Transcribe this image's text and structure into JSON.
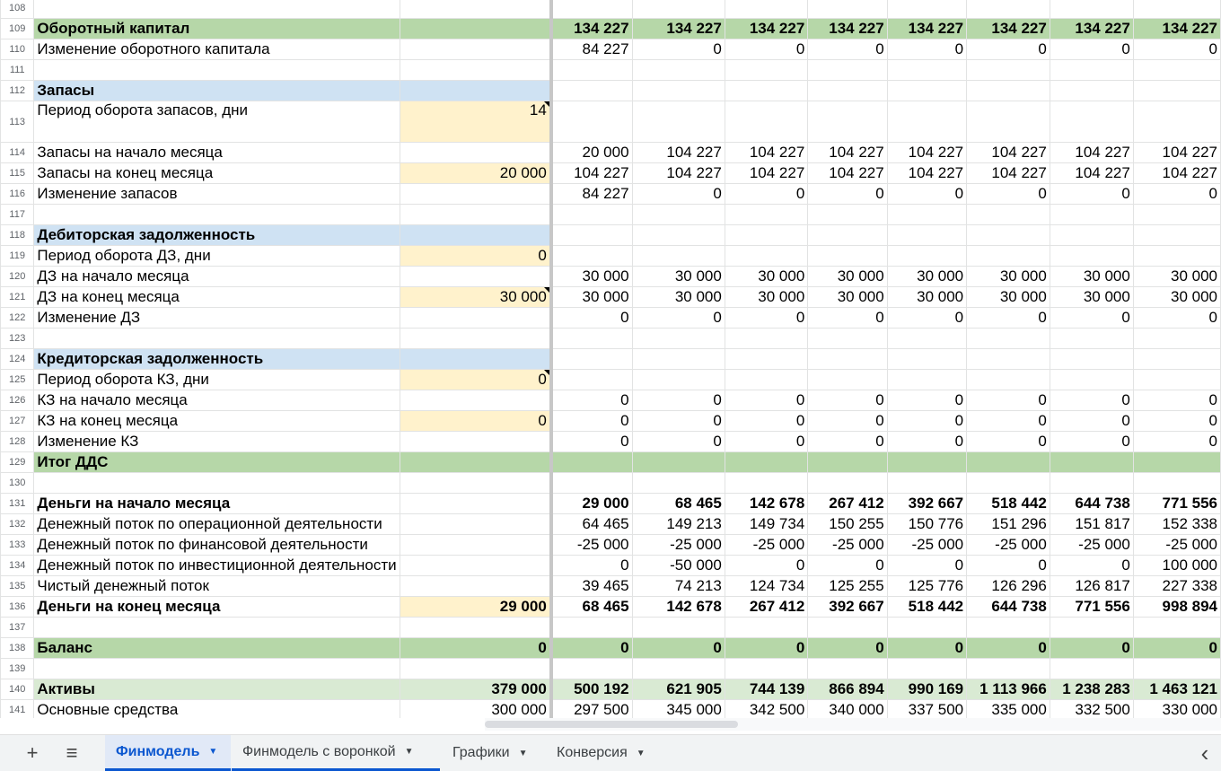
{
  "rows": [
    {
      "n": "108",
      "label": "",
      "input": "",
      "vals": [
        "",
        "",
        "",
        "",
        "",
        "",
        "",
        ""
      ],
      "style": ""
    },
    {
      "n": "109",
      "label": "Оборотный капитал",
      "input": "",
      "vals": [
        "134 227",
        "134 227",
        "134 227",
        "134 227",
        "134 227",
        "134 227",
        "134 227",
        "134 227"
      ],
      "style": "green"
    },
    {
      "n": "110",
      "label": "Изменение оборотного капитала",
      "input": "",
      "vals": [
        "84 227",
        "0",
        "0",
        "0",
        "0",
        "0",
        "0",
        "0"
      ],
      "style": ""
    },
    {
      "n": "111",
      "label": "",
      "input": "",
      "vals": [
        "",
        "",
        "",
        "",
        "",
        "",
        "",
        ""
      ],
      "style": ""
    },
    {
      "n": "112",
      "label": "Запасы",
      "input": "",
      "vals": [
        "",
        "",
        "",
        "",
        "",
        "",
        "",
        ""
      ],
      "style": "blue"
    },
    {
      "n": "113",
      "label": "Период оборота запасов, дни",
      "input": "14",
      "vals": [
        "",
        "",
        "",
        "",
        "",
        "",
        "",
        ""
      ],
      "style": "tall",
      "inputCell": true,
      "note": true
    },
    {
      "n": "114",
      "label": "Запасы на начало месяца",
      "input": "",
      "vals": [
        "20 000",
        "104 227",
        "104 227",
        "104 227",
        "104 227",
        "104 227",
        "104 227",
        "104 227"
      ],
      "style": ""
    },
    {
      "n": "115",
      "label": "Запасы на конец месяца",
      "input": "20 000",
      "vals": [
        "104 227",
        "104 227",
        "104 227",
        "104 227",
        "104 227",
        "104 227",
        "104 227",
        "104 227"
      ],
      "style": "",
      "inputCell": true
    },
    {
      "n": "116",
      "label": "Изменение запасов",
      "input": "",
      "vals": [
        "84 227",
        "0",
        "0",
        "0",
        "0",
        "0",
        "0",
        "0"
      ],
      "style": ""
    },
    {
      "n": "117",
      "label": "",
      "input": "",
      "vals": [
        "",
        "",
        "",
        "",
        "",
        "",
        "",
        ""
      ],
      "style": ""
    },
    {
      "n": "118",
      "label": "Дебиторская задолженность",
      "input": "",
      "vals": [
        "",
        "",
        "",
        "",
        "",
        "",
        "",
        ""
      ],
      "style": "blue"
    },
    {
      "n": "119",
      "label": "Период оборота ДЗ, дни",
      "input": "0",
      "vals": [
        "",
        "",
        "",
        "",
        "",
        "",
        "",
        ""
      ],
      "style": "",
      "inputCell": true
    },
    {
      "n": "120",
      "label": "ДЗ на начало месяца",
      "input": "",
      "vals": [
        "30 000",
        "30 000",
        "30 000",
        "30 000",
        "30 000",
        "30 000",
        "30 000",
        "30 000"
      ],
      "style": ""
    },
    {
      "n": "121",
      "label": "ДЗ на конец месяца",
      "input": "30 000",
      "vals": [
        "30 000",
        "30 000",
        "30 000",
        "30 000",
        "30 000",
        "30 000",
        "30 000",
        "30 000"
      ],
      "style": "",
      "inputCell": true,
      "note": true
    },
    {
      "n": "122",
      "label": "Изменение ДЗ",
      "input": "",
      "vals": [
        "0",
        "0",
        "0",
        "0",
        "0",
        "0",
        "0",
        "0"
      ],
      "style": ""
    },
    {
      "n": "123",
      "label": "",
      "input": "",
      "vals": [
        "",
        "",
        "",
        "",
        "",
        "",
        "",
        ""
      ],
      "style": ""
    },
    {
      "n": "124",
      "label": "Кредиторская задолженность",
      "input": "",
      "vals": [
        "",
        "",
        "",
        "",
        "",
        "",
        "",
        ""
      ],
      "style": "blue"
    },
    {
      "n": "125",
      "label": "Период оборота КЗ, дни",
      "input": "0",
      "vals": [
        "",
        "",
        "",
        "",
        "",
        "",
        "",
        ""
      ],
      "style": "",
      "inputCell": true,
      "note": true
    },
    {
      "n": "126",
      "label": "КЗ на начало месяца",
      "input": "",
      "vals": [
        "0",
        "0",
        "0",
        "0",
        "0",
        "0",
        "0",
        "0"
      ],
      "style": ""
    },
    {
      "n": "127",
      "label": "КЗ на конец месяца",
      "input": "0",
      "vals": [
        "0",
        "0",
        "0",
        "0",
        "0",
        "0",
        "0",
        "0"
      ],
      "style": "",
      "inputCell": true
    },
    {
      "n": "128",
      "label": "Изменение КЗ",
      "input": "",
      "vals": [
        "0",
        "0",
        "0",
        "0",
        "0",
        "0",
        "0",
        "0"
      ],
      "style": ""
    },
    {
      "n": "129",
      "label": "Итог ДДС",
      "input": "",
      "vals": [
        "",
        "",
        "",
        "",
        "",
        "",
        "",
        ""
      ],
      "style": "green"
    },
    {
      "n": "130",
      "label": "",
      "input": "",
      "vals": [
        "",
        "",
        "",
        "",
        "",
        "",
        "",
        ""
      ],
      "style": ""
    },
    {
      "n": "131",
      "label": "Деньги на начало месяца",
      "input": "",
      "vals": [
        "29 000",
        "68 465",
        "142 678",
        "267 412",
        "392 667",
        "518 442",
        "644 738",
        "771 556"
      ],
      "style": "bold"
    },
    {
      "n": "132",
      "label": "Денежный поток по операционной деятельности",
      "input": "",
      "vals": [
        "64 465",
        "149 213",
        "149 734",
        "150 255",
        "150 776",
        "151 296",
        "151 817",
        "152 338"
      ],
      "style": ""
    },
    {
      "n": "133",
      "label": "Денежный поток по финансовой деятельности",
      "input": "",
      "vals": [
        "-25 000",
        "-25 000",
        "-25 000",
        "-25 000",
        "-25 000",
        "-25 000",
        "-25 000",
        "-25 000"
      ],
      "style": ""
    },
    {
      "n": "134",
      "label": "Денежный поток по инвестиционной деятельности",
      "input": "",
      "vals": [
        "0",
        "-50 000",
        "0",
        "0",
        "0",
        "0",
        "0",
        "100 000"
      ],
      "style": ""
    },
    {
      "n": "135",
      "label": "Чистый денежный поток",
      "input": "",
      "vals": [
        "39 465",
        "74 213",
        "124 734",
        "125 255",
        "125 776",
        "126 296",
        "126 817",
        "227 338"
      ],
      "style": ""
    },
    {
      "n": "136",
      "label": "Деньги на конец месяца",
      "input": "29 000",
      "vals": [
        "68 465",
        "142 678",
        "267 412",
        "392 667",
        "518 442",
        "644 738",
        "771 556",
        "998 894"
      ],
      "style": "bold",
      "inputCell": true
    },
    {
      "n": "137",
      "label": "",
      "input": "",
      "vals": [
        "",
        "",
        "",
        "",
        "",
        "",
        "",
        ""
      ],
      "style": ""
    },
    {
      "n": "138",
      "label": "Баланс",
      "input": "0",
      "vals": [
        "0",
        "0",
        "0",
        "0",
        "0",
        "0",
        "0",
        "0"
      ],
      "style": "green bold"
    },
    {
      "n": "139",
      "label": "",
      "input": "",
      "vals": [
        "",
        "",
        "",
        "",
        "",
        "",
        "",
        ""
      ],
      "style": ""
    },
    {
      "n": "140",
      "label": "Активы",
      "input": "379 000",
      "vals": [
        "500 192",
        "621 905",
        "744 139",
        "866 894",
        "990 169",
        "1 113 966",
        "1 238 283",
        "1 463 121"
      ],
      "style": "lgreen bold"
    },
    {
      "n": "141",
      "label": "Основные средства",
      "input": "300 000",
      "vals": [
        "297 500",
        "345 000",
        "342 500",
        "340 000",
        "337 500",
        "335 000",
        "332 500",
        "330 000"
      ],
      "style": ""
    }
  ],
  "tabbar": {
    "add_icon": "+",
    "menu_icon": "≡",
    "tabs": [
      {
        "label": "Финмодель",
        "active": true
      },
      {
        "label": "Финмодель с воронкой",
        "active": false
      },
      {
        "label": "Графики",
        "active": false
      },
      {
        "label": "Конверсия",
        "active": false
      }
    ],
    "scroll_left_icon": "‹"
  }
}
